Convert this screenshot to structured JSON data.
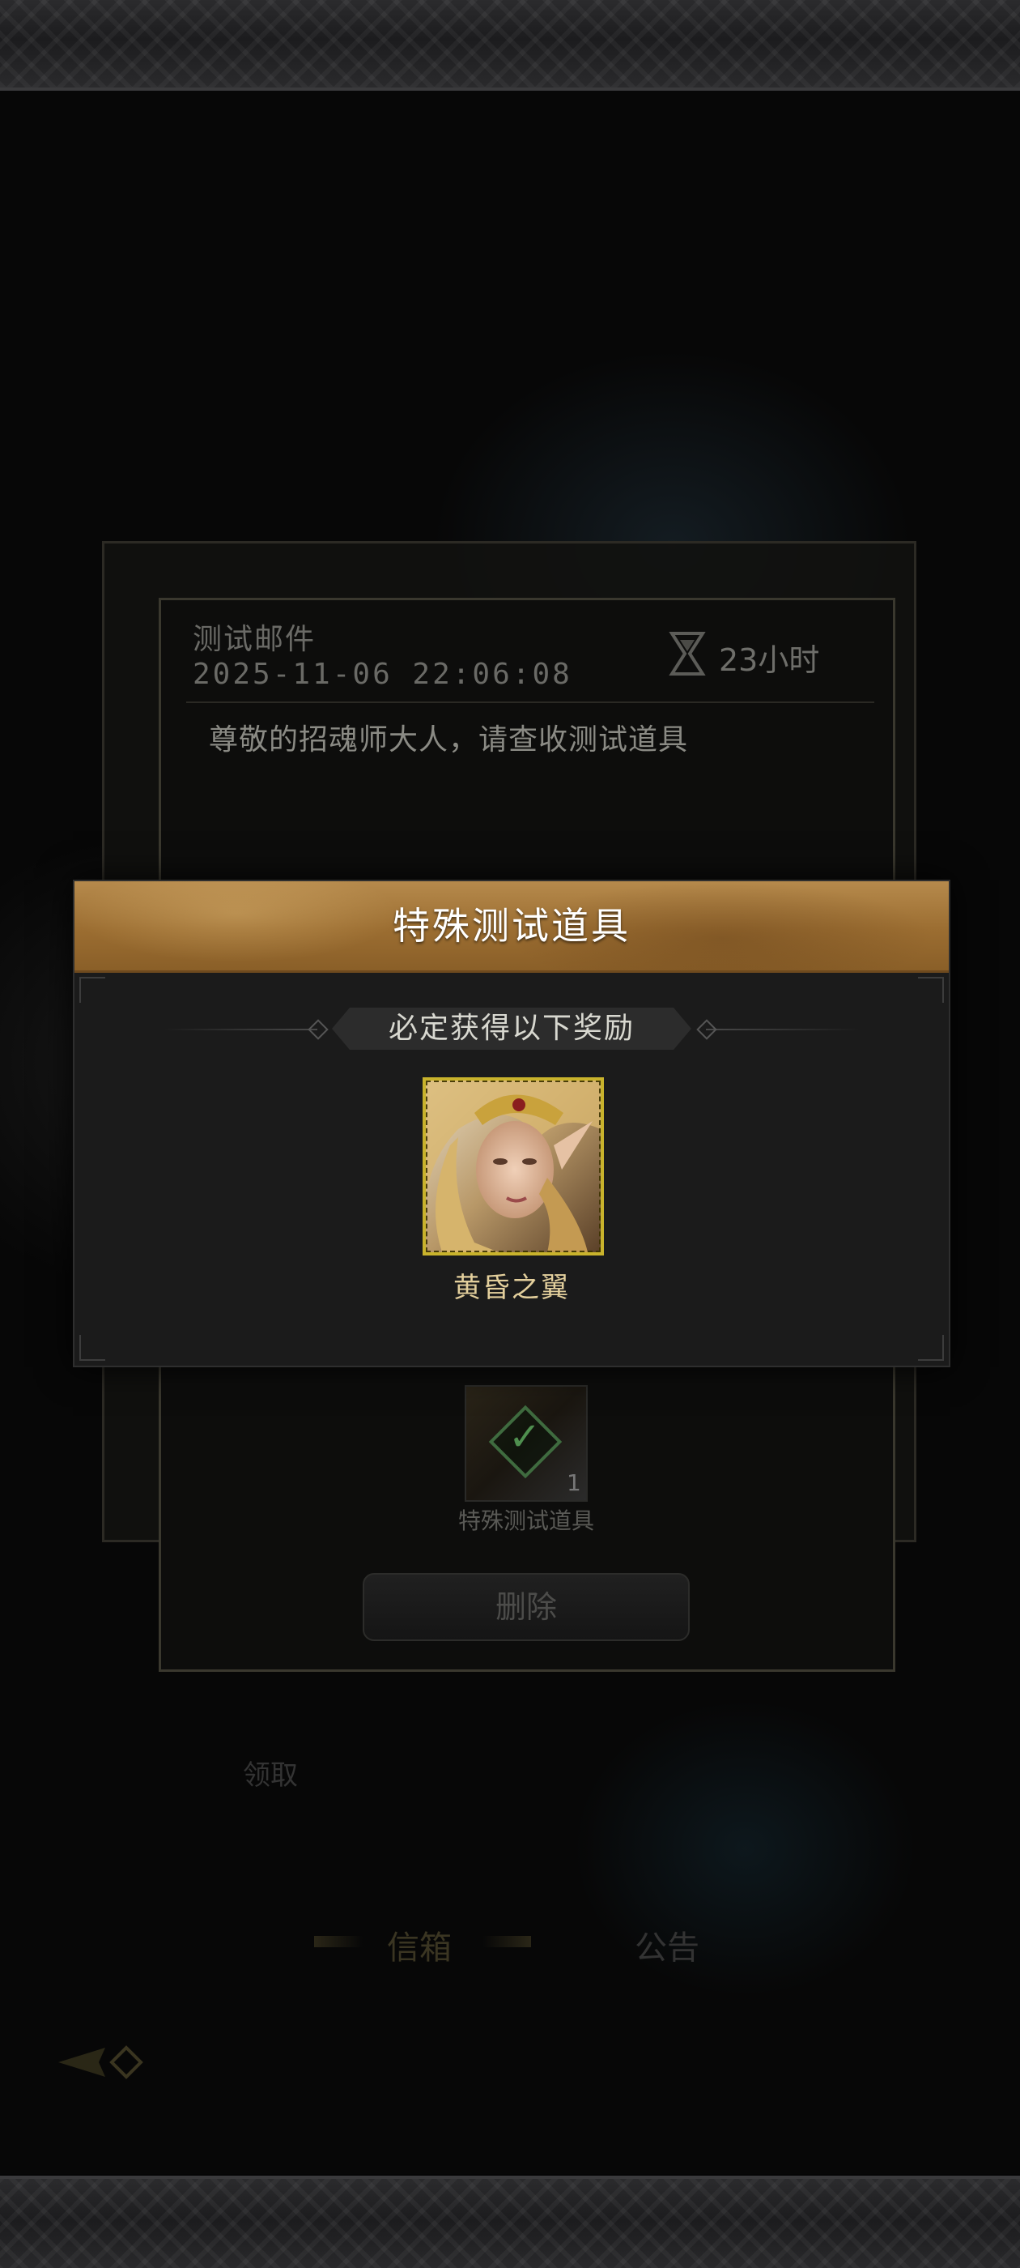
{
  "mail": {
    "subject": "测试邮件",
    "date": "2025-11-06  22:06:08",
    "expire": "23小时",
    "body": "尊敬的招魂师大人，请查收测试道具",
    "attachment": {
      "label": "特殊测试道具",
      "count": "1",
      "claimed": true
    },
    "delete_label": "删除"
  },
  "tabs": {
    "inbox_label": "信箱",
    "notice_label": "公告",
    "faded_label": "领取"
  },
  "popup": {
    "title": "特殊测试道具",
    "subtitle": "必定获得以下奖励",
    "reward": {
      "name": "黄昏之翼",
      "frame_color": "#c9b32c"
    }
  },
  "colors": {
    "header_gold": "#9b6d31",
    "reward_name": "#e3cf9c"
  },
  "icons": [
    "hourglass-icon",
    "check-icon",
    "back-arrow-icon"
  ]
}
